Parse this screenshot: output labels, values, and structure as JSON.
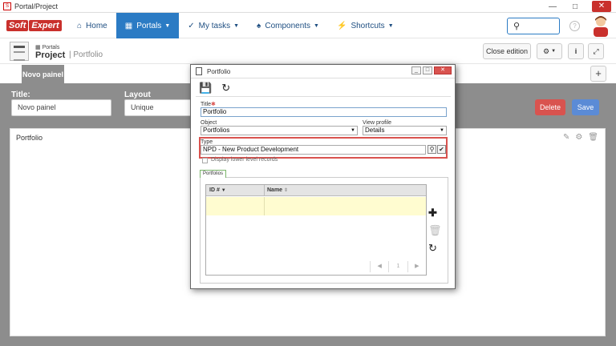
{
  "window": {
    "title": "Portal/Project"
  },
  "brand": {
    "part1": "Soft",
    "part2": "Expert"
  },
  "nav": [
    {
      "label": "Home",
      "icon": "⌂"
    },
    {
      "label": "Portals",
      "icon": "▦"
    },
    {
      "label": "My tasks",
      "icon": "✓"
    },
    {
      "label": "Components",
      "icon": "♠"
    },
    {
      "label": "Shortcuts",
      "icon": "⚡"
    }
  ],
  "header": {
    "section": "Portals",
    "title": "Project",
    "separator": "|",
    "breadcrumb": "Portfolio",
    "close_edition": "Close edition"
  },
  "tab": {
    "label": "Novo painel",
    "add": "+"
  },
  "form": {
    "title_label": "Title:",
    "title_value": "Novo painel",
    "layout_label": "Layout",
    "layout_value": "Unique",
    "delete": "Delete",
    "save": "Save"
  },
  "panel": {
    "title": "Portfolio"
  },
  "modal": {
    "title": "Portfolio",
    "title_label": "Title",
    "title_value": "Portfolio",
    "object_label": "Object",
    "object_value": "Portfolios",
    "view_label": "View profile",
    "view_value": "Details",
    "type_label": "Type",
    "type_value": "NPD - New Product Development",
    "checkbox_label": "Display lower level records",
    "group_tab": "Portfolios",
    "col_id": "ID #",
    "col_name": "Name",
    "page": "1"
  },
  "colors": {
    "accent": "#2b7bc4",
    "danger": "#d9534f",
    "save": "#5b8bd6",
    "content_bg": "#8d8d8d"
  }
}
